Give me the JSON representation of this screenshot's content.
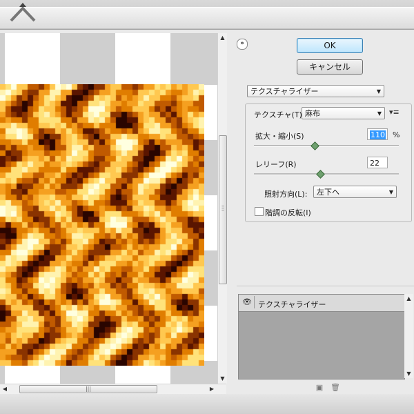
{
  "buttons": {
    "ok": "OK",
    "cancel": "キャンセル"
  },
  "filter": {
    "selected": "テクスチャライザー"
  },
  "texturizer": {
    "texture_label": "テクスチャ(T):",
    "texture_value": "麻布",
    "scaling_label": "拡大・縮小(S)",
    "scaling_value": "110",
    "scaling_unit": "%",
    "scaling_fraction": 0.4,
    "relief_label": "レリーフ(R)",
    "relief_value": "22",
    "relief_fraction": 0.44,
    "light_label": "照射方向(L):",
    "light_value": "左下へ",
    "invert_label": "階調の反転(I)",
    "invert_checked": false
  },
  "layers": [
    {
      "name": "テクスチャライザー",
      "visible": true
    }
  ],
  "icons": {
    "collapse": "double-chevron-icon",
    "panel_menu": "panel-menu-icon",
    "eye": "eye-icon",
    "new_layer": "new-layer-icon",
    "delete": "trash-icon"
  },
  "colors": {
    "accent": "#3399ff",
    "ok_border": "#3c7fb1",
    "texture_dark": "#3a0a00",
    "texture_light": "#ffffe0"
  }
}
